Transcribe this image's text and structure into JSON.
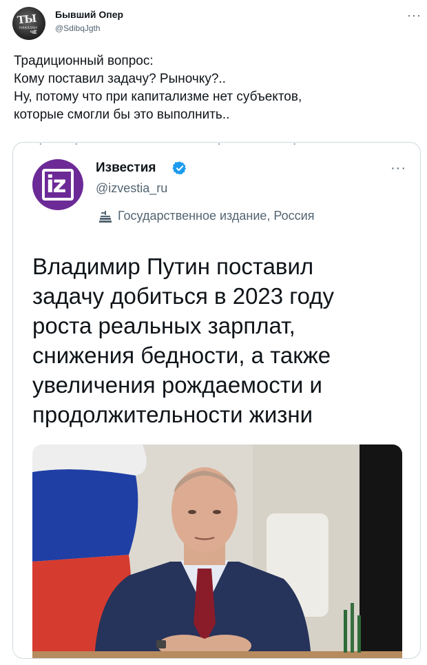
{
  "author": {
    "name": "Бывший Опер",
    "handle": "@SdibqJgth",
    "avatar_text": "ТЫ",
    "avatar_subtext": "НАКАЗАН",
    "avatar_corner": "ЧЁ"
  },
  "tweet": {
    "lines": [
      "Традиционный вопрос:",
      "Кому поставил задачу? Рыночку?..",
      "Ну, потому что при капитализме нет субъектов,",
      "которые смогли бы это выполнить.."
    ],
    "more_label": "···"
  },
  "quoted": {
    "name": "Известия",
    "handle": "@izvestia_ru",
    "avatar_text": "iz",
    "state_label": "Государственное издание, Россия",
    "more_label": "···",
    "headline_lines": [
      "Владимир Путин поставил",
      "задачу добиться в 2023 году",
      "роста реальных зарплат,",
      "снижения бедности, а также",
      "увеличения рождаемости и",
      "продолжительности жизни"
    ]
  },
  "colors": {
    "verified": "#1d9bf0",
    "brand_izvestia": "#6c2a96",
    "text_secondary": "#536471"
  }
}
